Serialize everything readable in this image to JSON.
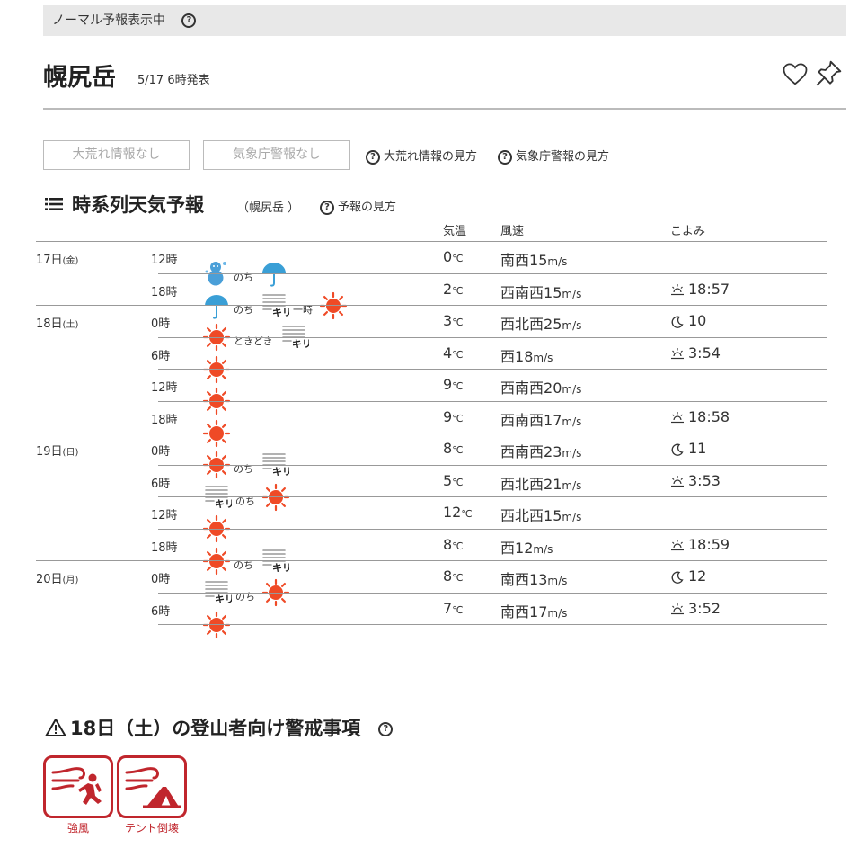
{
  "mode_bar": {
    "label": "ノーマル予報表示中",
    "help_icon": "question-circle-icon"
  },
  "header": {
    "mountain_name": "幌尻岳",
    "published": "5/17 6時発表",
    "favorite_icon": "heart-icon",
    "pin_icon": "pin-icon"
  },
  "alerts": {
    "storm_box": "大荒れ情報なし",
    "jma_box": "気象庁警報なし",
    "storm_help": "大荒れ情報の見方",
    "jma_help": "気象庁警報の見方"
  },
  "forecast": {
    "title": "時系列天気予報",
    "subtitle": "（幌尻岳 ）",
    "help": "予報の見方",
    "columns": {
      "temp": "気温",
      "wind": "風速",
      "koyomi": "こよみ"
    },
    "rows": [
      {
        "date": "17日",
        "dow": "(金)",
        "time": "12時",
        "temp": "0",
        "wind_dir": "南西",
        "wind_speed": "15",
        "koyomi_type": "",
        "koyomi": ""
      },
      {
        "date": "",
        "dow": "",
        "time": "18時",
        "temp": "2",
        "wind_dir": "西南西",
        "wind_speed": "15",
        "koyomi_type": "sunset",
        "koyomi": "18:57"
      },
      {
        "date": "18日",
        "dow": "(土)",
        "time": "0時",
        "temp": "3",
        "wind_dir": "西北西",
        "wind_speed": "25",
        "koyomi_type": "moon",
        "koyomi": "10"
      },
      {
        "date": "",
        "dow": "",
        "time": "6時",
        "temp": "4",
        "wind_dir": "西",
        "wind_speed": "18",
        "koyomi_type": "sunrise",
        "koyomi": "3:54"
      },
      {
        "date": "",
        "dow": "",
        "time": "12時",
        "temp": "9",
        "wind_dir": "西南西",
        "wind_speed": "20",
        "koyomi_type": "",
        "koyomi": ""
      },
      {
        "date": "",
        "dow": "",
        "time": "18時",
        "temp": "9",
        "wind_dir": "西南西",
        "wind_speed": "17",
        "koyomi_type": "sunset",
        "koyomi": "18:58"
      },
      {
        "date": "19日",
        "dow": "(日)",
        "time": "0時",
        "temp": "8",
        "wind_dir": "西南西",
        "wind_speed": "23",
        "koyomi_type": "moon",
        "koyomi": "11"
      },
      {
        "date": "",
        "dow": "",
        "time": "6時",
        "temp": "5",
        "wind_dir": "西北西",
        "wind_speed": "21",
        "koyomi_type": "sunrise",
        "koyomi": "3:53"
      },
      {
        "date": "",
        "dow": "",
        "time": "12時",
        "temp": "12",
        "wind_dir": "西北西",
        "wind_speed": "15",
        "koyomi_type": "",
        "koyomi": ""
      },
      {
        "date": "",
        "dow": "",
        "time": "18時",
        "temp": "8",
        "wind_dir": "西",
        "wind_speed": "12",
        "koyomi_type": "sunset",
        "koyomi": "18:59"
      },
      {
        "date": "20日",
        "dow": "(月)",
        "time": "0時",
        "temp": "8",
        "wind_dir": "南西",
        "wind_speed": "13",
        "koyomi_type": "moon",
        "koyomi": "12"
      },
      {
        "date": "",
        "dow": "",
        "time": "6時",
        "temp": "7",
        "wind_dir": "南西",
        "wind_speed": "17",
        "koyomi_type": "sunrise",
        "koyomi": "3:52"
      }
    ],
    "weather": [
      {
        "items": [
          "snowman-icon",
          "のち",
          "umbrella-icon"
        ]
      },
      {
        "items": [
          "umbrella-icon",
          "のち",
          "fog-icon",
          "一時",
          "sun-icon"
        ]
      },
      {
        "items": [
          "sun-icon",
          "ときどき",
          "fog-icon"
        ]
      },
      {
        "items": [
          "sun-icon"
        ]
      },
      {
        "items": [
          "sun-icon"
        ]
      },
      {
        "items": [
          "sun-icon"
        ]
      },
      {
        "items": [
          "sun-icon",
          "のち",
          "fog-icon"
        ]
      },
      {
        "items": [
          "fog-icon",
          "のち",
          "sun-icon"
        ]
      },
      {
        "items": [
          "sun-icon"
        ]
      },
      {
        "items": [
          "sun-icon",
          "のち",
          "fog-icon"
        ]
      },
      {
        "items": [
          "fog-icon",
          "のち",
          "sun-icon"
        ]
      },
      {
        "items": [
          "sun-icon"
        ]
      }
    ],
    "temp_unit": "℃",
    "wind_unit": "m/s",
    "fog_label": "キリ"
  },
  "mountaineer_warning": {
    "title": "18日（土）の登山者向け警戒事項",
    "items": [
      {
        "label": "強風",
        "icon": "strong-wind-icon"
      },
      {
        "label": "テント倒壊",
        "icon": "tent-collapse-icon"
      }
    ],
    "accent": "#c0262d"
  }
}
